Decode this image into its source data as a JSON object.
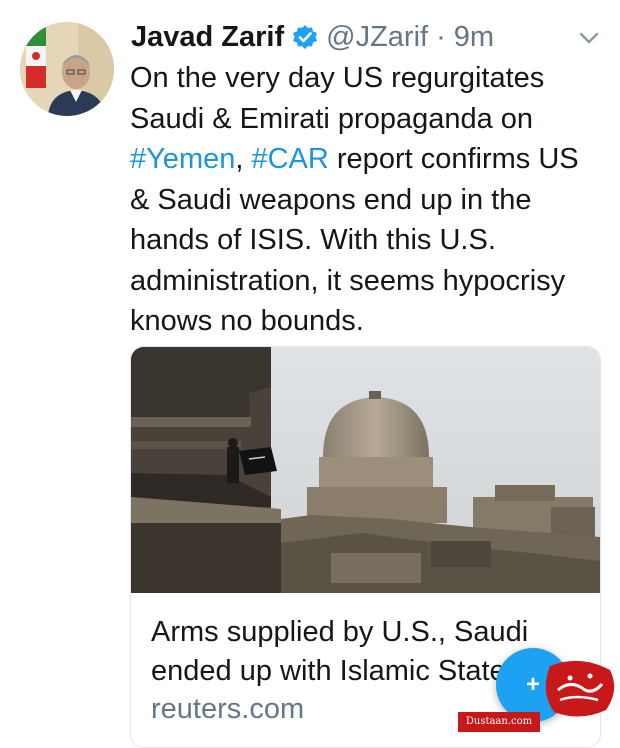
{
  "tweet": {
    "author_name": "Javad Zarif",
    "handle": "@JZarif",
    "separator": "·",
    "time": "9m",
    "text_parts": {
      "p1": "On the very day US regurgitates Saudi & Emirati propaganda on ",
      "tag1": "#Yemen",
      "comma": ", ",
      "tag2": "#CAR",
      "p2": " report confirms US & Saudi weapons end up in the hands of ISIS. With this U.S. administration, it seems hypocrisy knows no bounds."
    }
  },
  "card": {
    "title": "Arms supplied by U.S., Saudi ended up with Islamic State",
    "domain": "reuters.com"
  },
  "fab": {
    "label": "+"
  },
  "watermark": {
    "url": "Dustaan.com"
  },
  "icons": {
    "verified": "verified-badge-icon",
    "caret": "chevron-down-icon",
    "compose": "compose-plus-icon"
  },
  "colors": {
    "link_blue": "#1b95e0",
    "fab_blue": "#1da1f2",
    "secondary_text": "#657786",
    "watermark_red": "#c71919"
  }
}
